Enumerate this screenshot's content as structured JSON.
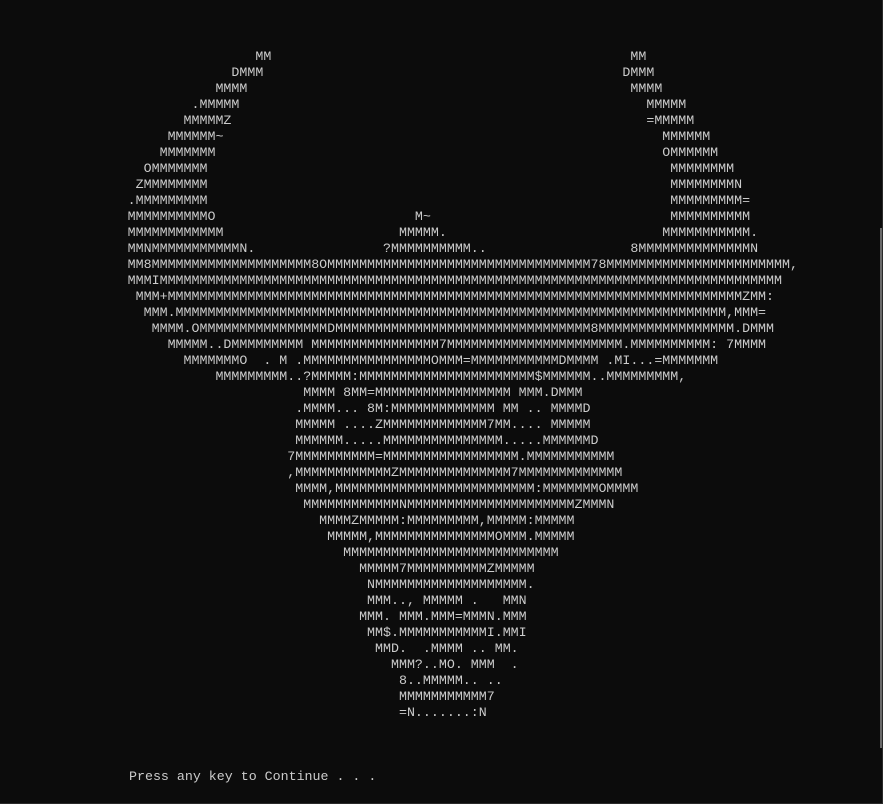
{
  "console": {
    "art_lines": [
      "                                MM                                             MM",
      "                             DMMM                                             DMMM",
      "                           MMMM                                                MMMM",
      "                        .MMMMM                                                   MMMMM",
      "                       MMMMMZ                                                    =MMMMM",
      "                     MMMMMM~                                                       MMMMMM",
      "                    MMMMMMM                                                        OMMMMMM",
      "                  OMMMMMMM                                                          MMMMMMMM",
      "                 ZMMMMMMMM                                                          MMMMMMMMN",
      "                .MMMMMMMMM                                                          MMMMMMMMM=",
      "                MMMMMMMMMMO                         M~                              MMMMMMMMMM",
      "                MMMMMMMMMMMM                      MMMMM.                           MMMMMMMMMMM.",
      "                MMNMMMMMMMMMMMN.                ?MMMMMMMMMM..                  8MMMMMMMMMMMMMMN",
      "                MM8MMMMMMMMMMMMMMMMMMMM8OMMMMMMMMMMMMMMMMMMMMMMMMMMMMMMMMM78MMMMMMMMMMMMMMMMMMMMMMM,",
      "                MMMIMMMMMMMMMMMMMMMMMMMMMMMMMMMMMMMMMMMMMMMMMMMMMMMMMMMMMMMMMMMMMMMMMMMMMMMMMMMMMM",
      "                 MMM+MMMMMMMMMMMMMMMMMMMMMMMMMMMMMMMMMMMMMMMMMMMMMMMMMMMMMMMMMMMMMMMMMMMMMMMMZMM:",
      "                  MMM.MMMMMMMMMMMMMMMMMMMMMMMMMMMMMMMMMMMMMMMMMMMMMMMMMMMMMMMMMMMMMMMMMMMMM,MMM=",
      "                   MMMM.OMMMMMMMMMMMMMMMMDMMMMMMMMMMMMMMMMMMMMMMMMMMMMMMMM8MMMMMMMMMMMMMMMMM.DMMM",
      "                     MMMMM..DMMMMMMMMM MMMMMMMMMMMMMMMM7MMMMMMMMMMMMMMMMMMMMMM.MMMMMMMMMM: 7MMMM",
      "                       MMMMMMMO  . M .MMMMMMMMMMMMMMMMOMMM=MMMMMMMMMMMDMMMM .MI...=MMMMMMM",
      "                           MMMMMMMMM..?MMMMM:MMMMMMMMMMMMMMMMMMMMMM$MMMMMM..MMMMMMMMM,",
      "                                      MMMM 8MM=MMMMMMMMMMMMMMMMM MMM.DMMM",
      "                                     .MMMM... 8M:MMMMMMMMMMMMM MM .. MMMMD",
      "                                     MMMMM ....ZMMMMMMMMMMMMM7MM.... MMMMM",
      "                                     MMMMMM.....MMMMMMMMMMMMMMM.....MMMMMMD",
      "                                    7MMMMMMMMMM=MMMMMMMMMMMMMMMMM.MMMMMMMMMMM",
      "                                    ,MMMMMMMMMMMMZMMMMMMMMMMMMMM7MMMMMMMMMMMMM",
      "                                     MMMM,MMMMMMMMMMMMMMMMMMMMMMMMM:MMMMMMMOMMMM",
      "                                      MMMMMMMMMMMMNMMMMMMMMMMMMMMMMMMMMMZMMMN",
      "                                        MMMMZMMMMM:MMMMMMMMM,MMMMM:MMMMM",
      "                                         MMMMM,MMMMMMMMMMMMMMMOMMM.MMMMM",
      "                                           MMMMMMMMMMMMMMMMMMMMMMMMMMM",
      "                                             MMMMM7MMMMMMMMMMZMMMMM",
      "                                              NMMMMMMMMMMMMMMMMMMM.",
      "                                              MMM.., MMMMM .   MMN",
      "                                             MMM. MMM.MMM=MMMN.MMM",
      "                                              MM$.MMMMMMMMMMMI.MMI",
      "                                               MMD.  .MMMM .. MM.",
      "                                                 MMM?..MO. MMM  .",
      "                                                  8..MMMMM.. ..",
      "                                                  MMMMMMMMMMM7",
      "                                                  =N.......:N"
    ],
    "prompt_text": "Press any key to Continue . . ."
  }
}
